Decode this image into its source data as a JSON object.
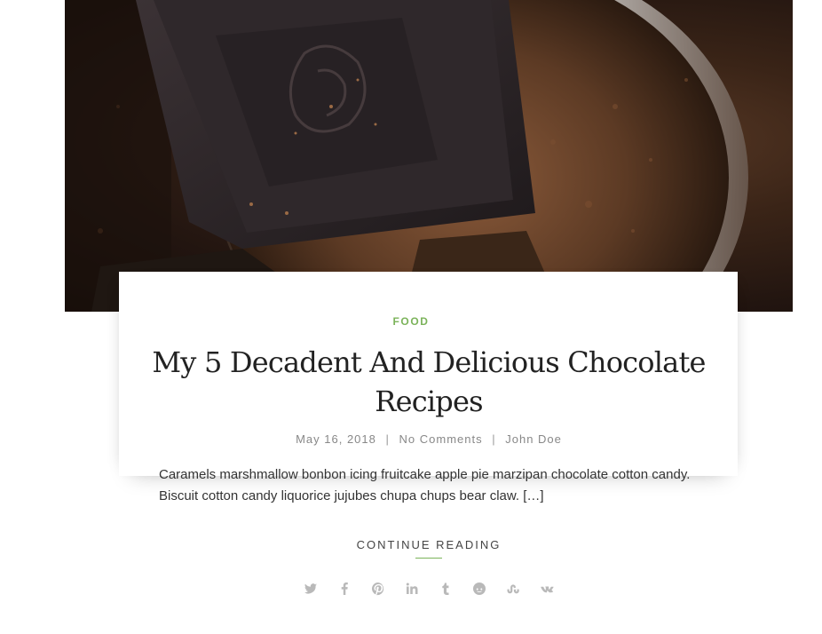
{
  "post": {
    "category": "FOOD",
    "title": "My 5 Decadent And Delicious Chocolate Recipes",
    "date": "May 16, 2018",
    "comments": "No Comments",
    "author": "John Doe",
    "excerpt": "Caramels marshmallow bonbon icing fruitcake apple pie marzipan chocolate cotton candy. Biscuit cotton candy liquorice jujubes chupa chups bear claw. […]",
    "continue_label": "CONTINUE READING",
    "separator": "|"
  },
  "share_icons": [
    "twitter-icon",
    "facebook-icon",
    "pinterest-icon",
    "linkedin-icon",
    "tumblr-icon",
    "reddit-icon",
    "stumbleupon-icon",
    "vk-icon"
  ],
  "colors": {
    "accent": "#7bb35a",
    "title": "#222222",
    "meta": "#888888",
    "icon": "#b9b9b9"
  }
}
